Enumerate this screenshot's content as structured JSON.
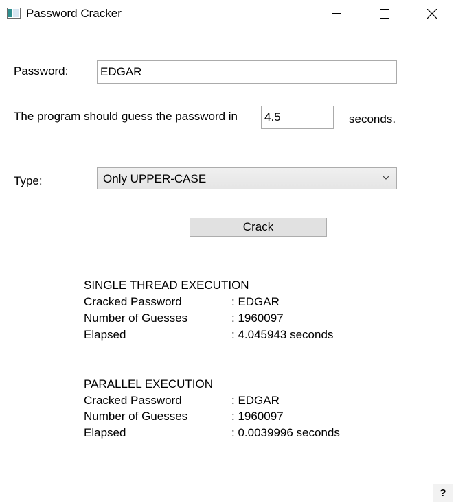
{
  "window": {
    "title": "Password Cracker"
  },
  "form": {
    "password_label": "Password:",
    "password_value": "EDGAR",
    "time_prefix": "The program should guess the password in",
    "time_value": "4.5",
    "time_suffix": "seconds.",
    "type_label": "Type:",
    "type_selected": "Only UPPER-CASE",
    "crack_label": "Crack"
  },
  "results": {
    "single": {
      "heading": "SINGLE THREAD EXECUTION",
      "rows": [
        {
          "label": "Cracked Password",
          "value": ": EDGAR"
        },
        {
          "label": "Number of Guesses",
          "value": ": 1960097"
        },
        {
          "label": "Elapsed",
          "value": ": 4.045943 seconds"
        }
      ]
    },
    "parallel": {
      "heading": "PARALLEL EXECUTION",
      "rows": [
        {
          "label": "Cracked Password",
          "value": ": EDGAR"
        },
        {
          "label": "Number of Guesses",
          "value": ": 1960097"
        },
        {
          "label": "Elapsed",
          "value": ": 0.0039996 seconds"
        }
      ]
    }
  },
  "help": {
    "label": "?"
  }
}
